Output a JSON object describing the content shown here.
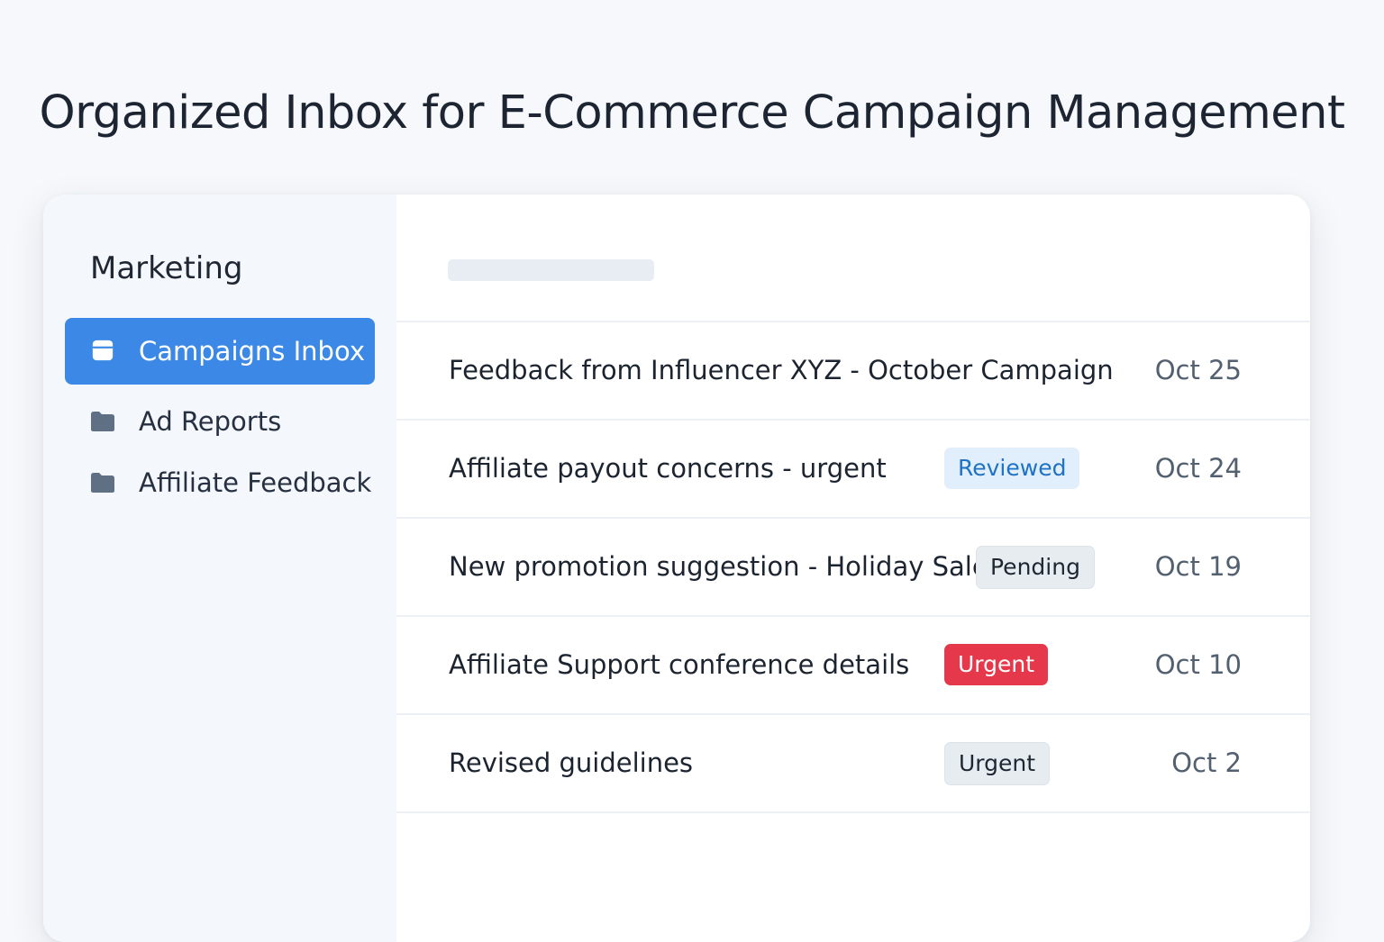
{
  "page": {
    "title": "Organized Inbox for E-Commerce Campaign Management"
  },
  "sidebar": {
    "title": "Marketing",
    "items": [
      {
        "label": "Campaigns Inbox",
        "icon": "inbox-icon",
        "active": true
      },
      {
        "label": "Ad Reports",
        "icon": "folder-icon",
        "active": false
      },
      {
        "label": "Affiliate Feedback",
        "icon": "folder-icon",
        "active": false
      }
    ]
  },
  "inbox": {
    "messages": [
      {
        "subject": "Feedback from Influencer XYZ - October Campaign",
        "badge": "",
        "date": "Oct 25"
      },
      {
        "subject": "Affiliate payout concerns - urgent",
        "badge": "Reviewed",
        "date": "Oct 24"
      },
      {
        "subject": "New promotion suggestion - Holiday Sale",
        "badge": "Pending",
        "date": "Oct 19"
      },
      {
        "subject": "Affiliate Support conference details",
        "badge": "Urgent",
        "date": "Oct 10"
      },
      {
        "subject": "Revised guidelines",
        "badge": "Urgent",
        "date": "Oct 2"
      }
    ]
  },
  "colors": {
    "accent": "#3b88e6",
    "reviewed_badge": "#e1effc",
    "urgent_badge": "#e5384a",
    "neutral_badge": "#e7ecf1"
  }
}
